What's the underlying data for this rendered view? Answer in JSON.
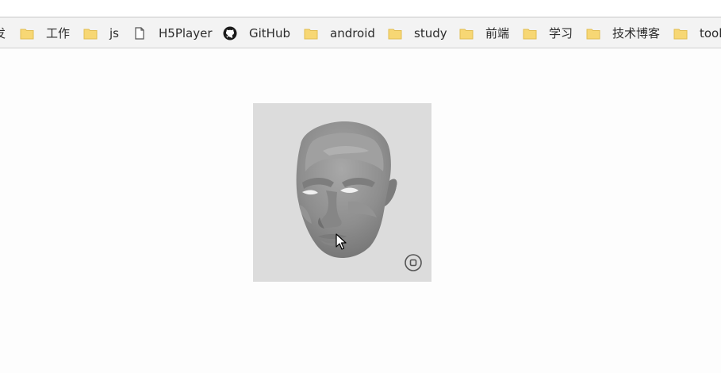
{
  "bookmarks_bar": {
    "items": [
      {
        "label": "发",
        "icon": "folder-icon"
      },
      {
        "label": "工作",
        "icon": "folder-icon"
      },
      {
        "label": "js",
        "icon": "folder-icon"
      },
      {
        "label": "H5Player",
        "icon": "page-icon"
      },
      {
        "label": "GitHub",
        "icon": "github-icon"
      },
      {
        "label": "android",
        "icon": "folder-icon"
      },
      {
        "label": "study",
        "icon": "folder-icon"
      },
      {
        "label": "前端",
        "icon": "folder-icon"
      },
      {
        "label": "学习",
        "icon": "folder-icon"
      },
      {
        "label": "技术博客",
        "icon": "folder-icon"
      },
      {
        "label": "tools",
        "icon": "folder-icon"
      }
    ]
  },
  "viewer": {
    "background": "#dcdcdc",
    "model": "3d-face-model",
    "control_icon": "record-icon"
  },
  "colors": {
    "folder": "#f7d774",
    "bar_bg": "#f3f3f3",
    "page_bg": "#fdfdfd"
  }
}
